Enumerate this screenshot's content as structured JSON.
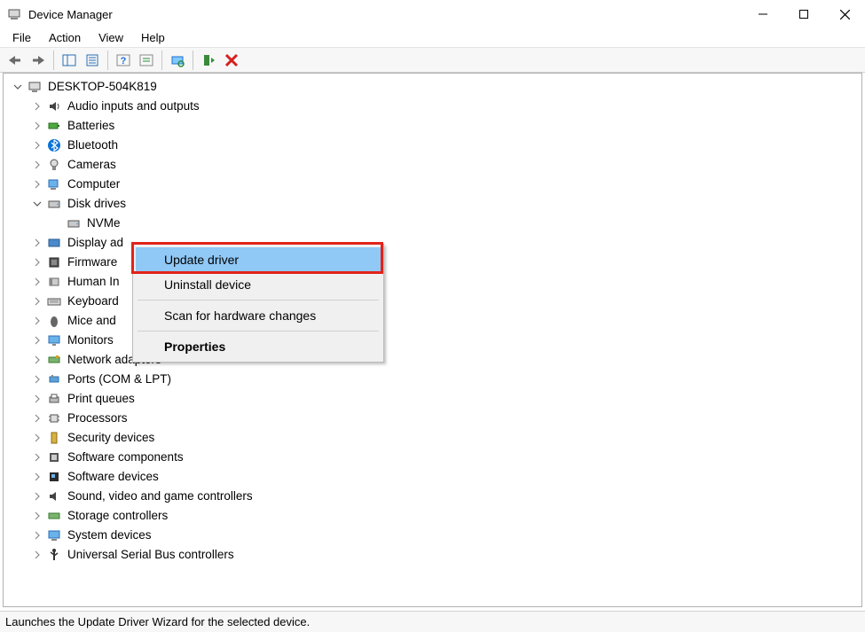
{
  "window": {
    "title": "Device Manager"
  },
  "menubar": {
    "file": "File",
    "action": "Action",
    "view": "View",
    "help": "Help"
  },
  "tree": {
    "root": "DESKTOP-504K819",
    "audio": "Audio inputs and outputs",
    "batteries": "Batteries",
    "bluetooth": "Bluetooth",
    "cameras": "Cameras",
    "computer": "Computer",
    "disk_drives": "Disk drives",
    "disk_child_prefix": "NVMe",
    "display": "Display ad",
    "firmware": "Firmware",
    "hid": "Human In",
    "keyboards": "Keyboard",
    "mice": "Mice and",
    "monitors": "Monitors",
    "network": "Network adapters",
    "ports": "Ports (COM & LPT)",
    "print_queues": "Print queues",
    "processors": "Processors",
    "security": "Security devices",
    "sw_components": "Software components",
    "sw_devices": "Software devices",
    "sound": "Sound, video and game controllers",
    "storage": "Storage controllers",
    "system": "System devices",
    "usb": "Universal Serial Bus controllers"
  },
  "context_menu": {
    "update_driver": "Update driver",
    "uninstall_device": "Uninstall device",
    "scan": "Scan for hardware changes",
    "properties": "Properties"
  },
  "statusbar": {
    "text": "Launches the Update Driver Wizard for the selected device."
  }
}
